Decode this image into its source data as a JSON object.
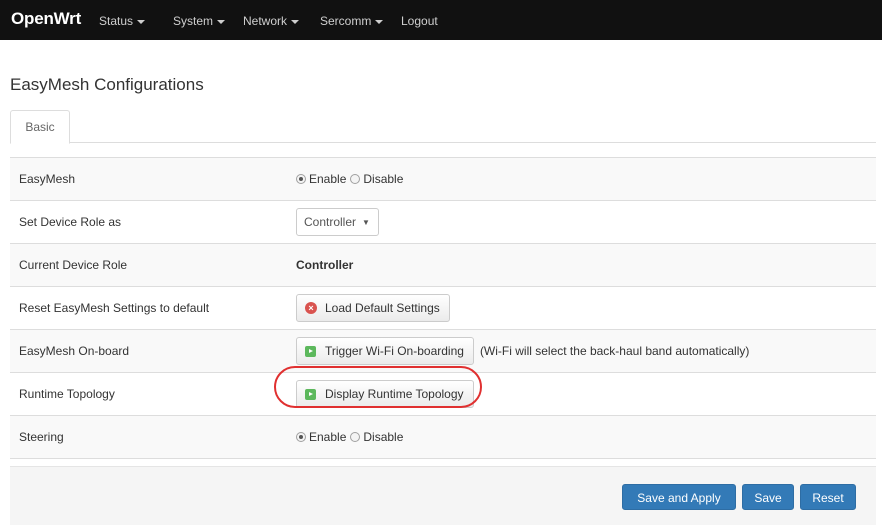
{
  "brand": "OpenWrt",
  "nav": {
    "status": "Status",
    "system": "System",
    "network": "Network",
    "sercomm": "Sercomm",
    "logout": "Logout"
  },
  "page_title": "EasyMesh Configurations",
  "tabs": [
    {
      "label": "Basic"
    }
  ],
  "rows": {
    "easymesh": {
      "label": "EasyMesh",
      "enable": "Enable",
      "disable": "Disable",
      "selected": "Enable"
    },
    "device_role": {
      "label": "Set Device Role as",
      "value": "Controller"
    },
    "current_role": {
      "label": "Current Device Role",
      "value": "Controller"
    },
    "reset": {
      "label": "Reset EasyMesh Settings to default",
      "button": "Load Default Settings"
    },
    "onboard": {
      "label": "EasyMesh On-board",
      "button": "Trigger Wi-Fi On-boarding",
      "hint": "(Wi-Fi will select the back-haul band automatically)"
    },
    "topology": {
      "label": "Runtime Topology",
      "button": "Display Runtime Topology"
    },
    "steering": {
      "label": "Steering",
      "enable": "Enable",
      "disable": "Disable",
      "selected": "Enable"
    }
  },
  "actions": {
    "save_apply": "Save and Apply",
    "save": "Save",
    "reset": "Reset"
  },
  "icons": {
    "reset_icon": "x-circle-icon",
    "play_icon": "play-icon",
    "dropdown_icon": "chevron-down-icon"
  },
  "colors": {
    "navbar": "#111111",
    "primary": "#337ab7",
    "highlight": "#e03030",
    "danger_icon": "#d9534f",
    "success_icon": "#5cb85c"
  }
}
